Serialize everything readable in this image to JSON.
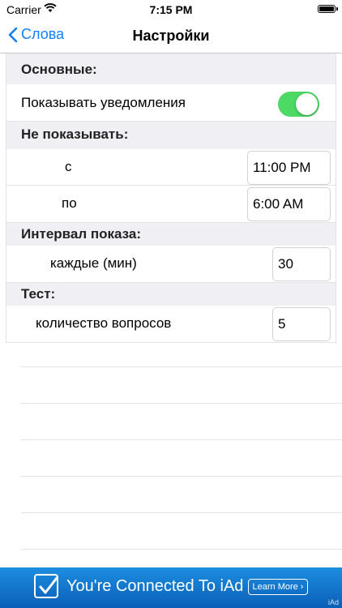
{
  "status": {
    "carrier": "Carrier",
    "time": "7:15 PM"
  },
  "nav": {
    "back_label": "Слова",
    "title": "Настройки"
  },
  "sections": {
    "basic": "Основные:",
    "show_notifications": "Показывать уведомления",
    "show_notifications_on": true,
    "dont_show": "Не показывать:",
    "from_label": "с",
    "from_value": "11:00 PM",
    "to_label": "по",
    "to_value": "6:00 AM",
    "interval": "Интервал показа:",
    "every_label": "каждые (мин)",
    "every_value": "30",
    "test": "Тест:",
    "questions_label": "количество вопросов",
    "questions_value": "5"
  },
  "ad": {
    "text": "You're Connected To iAd",
    "learn_more": "Learn More ›",
    "badge": "iAd"
  },
  "colors": {
    "accent": "#147efb",
    "toggle_on": "#4cd964",
    "section_bg": "#efeff4",
    "ad_bg": "#0a5fb6"
  }
}
